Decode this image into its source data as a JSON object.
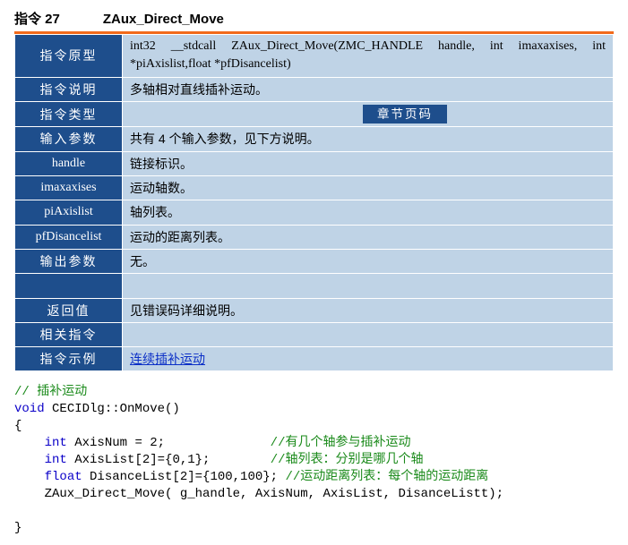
{
  "header": {
    "cmd_number_label": "指令 27",
    "cmd_name": "ZAux_Direct_Move"
  },
  "rows": {
    "proto_label": "指令原型",
    "proto_value": "int32    __stdcall   ZAux_Direct_Move(ZMC_HANDLE    handle,  int imaxaxises, int    *piAxislist,float    *pfDisancelist)",
    "desc_label": "指令说明",
    "desc_value": "多轴相对直线插补运动。",
    "type_label": "指令类型",
    "type_badge": "章节页码",
    "in_label": "输入参数",
    "in_value": "共有 4 个输入参数，见下方说明。",
    "p1_label": "handle",
    "p1_value": "链接标识。",
    "p2_label": "imaxaxises",
    "p2_value": "运动轴数。",
    "p3_label": "piAxislist",
    "p3_value": "轴列表。",
    "p4_label": "pfDisancelist",
    "p4_value": "运动的距离列表。",
    "out_label": "输出参数",
    "out_value": "无。",
    "blank_value": "",
    "ret_label": "返回值",
    "ret_value": "见错误码详细说明。",
    "rel_label": "相关指令",
    "rel_value": "",
    "ex_label": "指令示例",
    "ex_link": "连续插补运动"
  },
  "code": {
    "c_top": "// 插补运动",
    "fn_sig_pre": "void",
    "fn_sig_rest": " CECIDlg::OnMove()",
    "brace_open": "{",
    "l1_kw": "int",
    "l1_rest": " AxisNum = 2;",
    "l1_comment": "//有几个轴参与插补运动",
    "l2_kw": "int",
    "l2_rest": " AxisList[2]={0,1};",
    "l2_comment": "//轴列表：分别是哪几个轴",
    "l3_kw": "float",
    "l3_rest": " DisanceList[2]={100,100};",
    "l3_comment": "//运动距离列表：每个轴的运动距离",
    "l4": "    ZAux_Direct_Move( g_handle, AxisNum, AxisList, DisanceListt);",
    "brace_close": "}"
  }
}
